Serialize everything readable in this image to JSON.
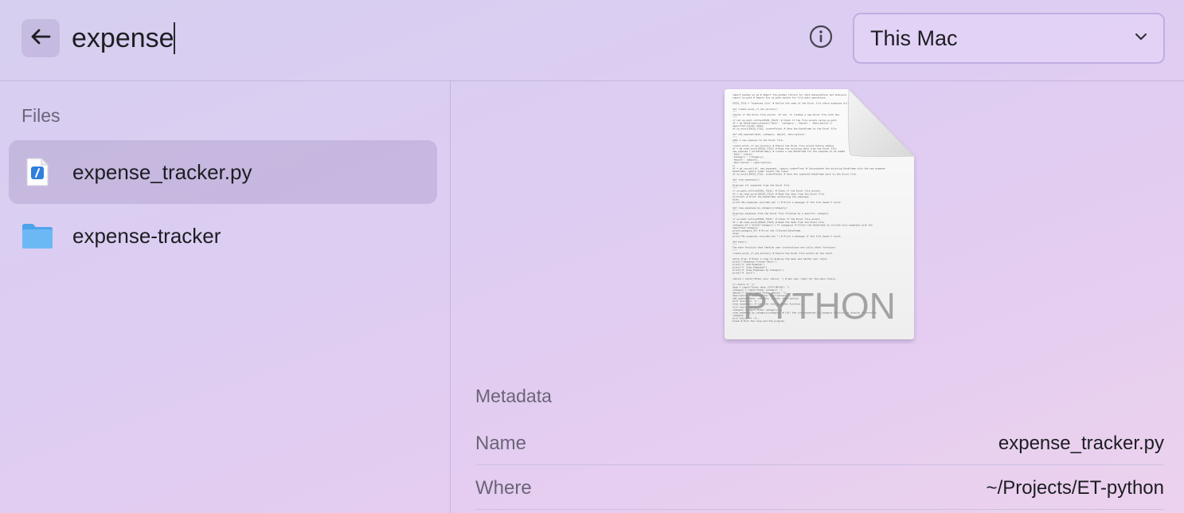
{
  "search": {
    "query": "expense",
    "scope": "This Mac"
  },
  "colors": {
    "folder": "#6cb8f5",
    "python_badge": "#2f7fdb"
  },
  "icons": {
    "back": "arrow-left-icon",
    "info": "info-circle-icon",
    "dropdown": "chevron-down-icon",
    "python_file": "python-file-icon",
    "folder": "folder-icon"
  },
  "sidebar": {
    "section_title": "Files",
    "items": [
      {
        "label": "expense_tracker.py",
        "kind": "python-file",
        "selected": true
      },
      {
        "label": "expense-tracker",
        "kind": "folder",
        "selected": false
      }
    ]
  },
  "preview": {
    "badge_text": "PYTHON",
    "code_lines": [
      "import pandas as pd  # Import the pandas library for data manipulation and analysis.",
      "import os.path  # Import the os.path module for file path operations.",
      "",
      "EXCEL_FILE = \"expenses.xlsx\"  # Define the name of the Excel file where expenses will be stored.",
      "",
      "def create_excel_if_not_exists():",
      "    \"\"\"",
      "    Checks if the Excel file exists. If not, it creates a new Excel file with the",
      "    \"\"\"",
      "    if not os.path.isfile(EXCEL_FILE):  # Check if the file exists using os.path",
      "        df = pd.DataFrame(columns=['Date', 'Category', 'Amount', 'Description'])",
      "specified column names.",
      "        df.to_excel(EXCEL_FILE, index=False)  # Save the DataFrame to the Excel file",
      "",
      "def add_expense(date, category, amount, description):",
      "    \"\"\"",
      "    Adds a new expense to the Excel file.",
      "    \"\"\"",
      "    create_excel_if_not_exists()  # Ensure the Excel file exists before adding",
      "    df = pd.read_excel(EXCEL_FILE)  # Read the existing data from the Excel file",
      "    new_expense = pd.DataFrame({  # Create a new DataFrame for the expense to be added",
      "        'Date': [date],",
      "        'Category': [category],",
      "        'Amount': [amount],",
      "        'Description': [description]",
      "    })",
      "    df = pd.concat([df, new_expense], ignore_index=True)  # Concatenate the existing DataFrame with the new expense",
      "DataFrame, ignore_index resets the index.",
      "    df.to_excel(EXCEL_FILE, index=False)  # Save the combined DataFrame back to the Excel file.",
      "",
      "def view_expenses():",
      "    \"\"\"",
      "    Displays all expenses from the Excel file.",
      "    \"\"\"",
      "    if os.path.isfile(EXCEL_FILE):  # Check if the Excel file exists.",
      "        df = pd.read_excel(EXCEL_FILE)  # Read the data from the Excel file.",
      "        print(df)  # Print the DataFrame containing the expenses.",
      "    else:",
      "        print(\"No expenses recorded yet.\")  # Print a message if the file doesn't exist.",
      "",
      "def view_expenses_by_category(category):",
      "    \"\"\"",
      "    Displays expenses from the Excel file filtered by a specific category.",
      "    \"\"\"",
      "    if os.path.isfile(EXCEL_FILE):  # Check if the Excel file exists.",
      "        df = pd.read_excel(EXCEL_FILE)  # Read the data from the Excel file.",
      "        category_df = df[df['Category'] == category]  # Filter the DataFrame to include only expenses with the",
      "specified category.",
      "        print(category_df)  # Print the filtered DataFrame.",
      "    else:",
      "        print(\"No expenses recorded yet.\")  # Print a message if the file doesn't exist.",
      "",
      "def main():",
      "    \"\"\"",
      "    The main function that handles user interactions and calls other functions.",
      "    \"\"\"",
      "    create_excel_if_not_exists()  # Ensure the Excel file exists at the start.",
      "",
      "    while True:  # Enter a loop to display the menu and handle user input.",
      "        print(\"\\nExpense Tracker Menu:\")",
      "        print(\"1. Add Expense\")",
      "        print(\"2. View Expenses\")",
      "        print(\"3. View Expenses by Category\")",
      "        print(\"4. Exit\")",
      "",
      "        choice = input(\"Enter your choice: \")  # Get user input for the menu choice.",
      "",
      "        if choice == '1':",
      "            date = input(\"Enter date (YYYY-MM-DD): \")",
      "            category = input(\"Enter category: \")",
      "            amount = float(input(\"Enter amount: \"))",
      "            description = input(\"Enter description: \")",
      "            add_expense(date, category, amount, description)",
      "        elif choice == '2':",
      "            view_expenses()  # Call the view_expenses function.",
      "        elif choice == '3':",
      "            category = input(\"Enter category: \")",
      "            view_expenses_by_category(category)  # Call the view_expenses_by_category function to display filtered by",
      "category.",
      "        elif choice == '4':",
      "            break  # Exit the loop and the program."
    ]
  },
  "metadata": {
    "title": "Metadata",
    "rows": [
      {
        "key": "Name",
        "value": "expense_tracker.py"
      },
      {
        "key": "Where",
        "value": "~/Projects/ET-python"
      }
    ]
  }
}
